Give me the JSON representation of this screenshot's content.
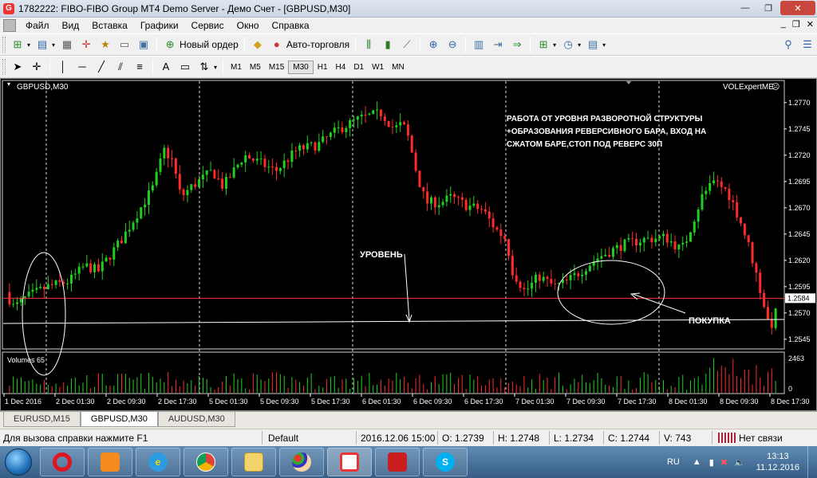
{
  "window": {
    "title": "1782222: FIBO-FIBO Group MT4 Demo Server - Демо Счет - [GBPUSD,M30]",
    "controls": {
      "minimize": "—",
      "restore": "❐",
      "close": "✕"
    }
  },
  "menu": {
    "items": [
      "Файл",
      "Вид",
      "Вставка",
      "Графики",
      "Сервис",
      "Окно",
      "Справка"
    ],
    "mdi": {
      "minimize": "_",
      "restore": "❐",
      "close": "✕"
    }
  },
  "toolbar": {
    "new_order": "Новый ордер",
    "autotrading": "Авто-торговля",
    "timeframes": [
      "M1",
      "M5",
      "M15",
      "M30",
      "H1",
      "H4",
      "D1",
      "W1",
      "MN"
    ],
    "active_timeframe": "M30"
  },
  "chart": {
    "symbol_label": "GBPUSD,M30",
    "expert_label": "VOLExpertME",
    "annotation_text": [
      "РАБОТА ОТ УРОВНЯ РАЗВОРОТНОЙ СТРУКТУРЫ",
      "+ОБРАЗОВАНИЯ РЕВЕРСИВНОГО БАРА, ВХОД НА",
      "СЖАТОМ БАРЕ,СТОП ПОД РЕВЕРС 30П"
    ],
    "level_label": "УРОВЕНЬ",
    "buy_label": "ПОКУПКА",
    "current_price": "1.2584",
    "price_ticks": [
      "1.2770",
      "1.2745",
      "1.2720",
      "1.2695",
      "1.2670",
      "1.2645",
      "1.2620",
      "1.2595",
      "1.2570",
      "1.2545"
    ],
    "volumes_label": "Volumes 65",
    "volume_ticks": [
      "2463",
      "0"
    ],
    "time_ticks": [
      "1 Dec 2016",
      "2 Dec 01:30",
      "2 Dec 09:30",
      "2 Dec 17:30",
      "5 Dec 01:30",
      "5 Dec 09:30",
      "5 Dec 17:30",
      "6 Dec 01:30",
      "6 Dec 09:30",
      "6 Dec 17:30",
      "7 Dec 01:30",
      "7 Dec 09:30",
      "7 Dec 17:30",
      "8 Dec 01:30",
      "8 Dec 09:30",
      "8 Dec 17:30"
    ],
    "colors": {
      "bull": "#1fd11f",
      "bear": "#ff2a2a",
      "background": "#000000",
      "level_line": "#ffffff",
      "bid_line": "#ff3030"
    }
  },
  "tabs": [
    {
      "label": "EURUSD,M15",
      "active": false
    },
    {
      "label": "GBPUSD,M30",
      "active": true
    },
    {
      "label": "AUDUSD,M30",
      "active": false
    }
  ],
  "status": {
    "help": "Для вызова справки нажмите F1",
    "profile": "Default",
    "datetime": "2016.12.06 15:00",
    "open": "O: 1.2739",
    "high": "H: 1.2748",
    "low": "L: 1.2734",
    "close": "C: 1.2744",
    "volume": "V: 743",
    "connection": "Нет связи"
  },
  "taskbar": {
    "apps": [
      "start-button",
      "opera-app",
      "media-player-app",
      "internet-explorer-app",
      "chrome-app",
      "file-explorer-app",
      "paint-app",
      "fibo-group-app",
      "acrobat-app",
      "skype-app"
    ],
    "lang": "RU",
    "time": "13:13",
    "date": "11.12.2016"
  }
}
